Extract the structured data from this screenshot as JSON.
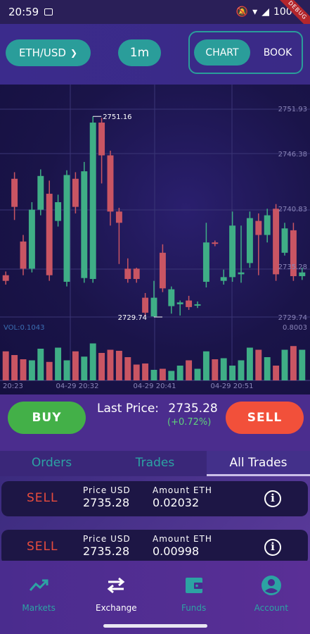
{
  "status": {
    "time": "20:59",
    "battery": "100%",
    "debug_label": "DEBUG"
  },
  "header": {
    "pair": "ETH/USD",
    "timeframe": "1m",
    "view_tabs": [
      {
        "label": "CHART",
        "active": true
      },
      {
        "label": "BOOK",
        "active": false
      }
    ]
  },
  "chart_data": {
    "type": "candlestick",
    "y_tick_labels": [
      "2751.93",
      "2746.38",
      "2740.83",
      "2735.28",
      "2729.74",
      "0.8003"
    ],
    "x_tick_labels": [
      "20:23",
      "04-29 20:32",
      "04-29 20:41",
      "04-29 20:51"
    ],
    "high_label": "2751.16",
    "low_label": "2729.74",
    "volume_label": "VOL:0.1043",
    "ylim": [
      2729.74,
      2751.93
    ],
    "candles": [
      {
        "o": 2734.2,
        "c": 2733.6,
        "h": 2734.6,
        "l": 2733.2
      },
      {
        "o": 2744.5,
        "c": 2741.5,
        "h": 2745.2,
        "l": 2740.1
      },
      {
        "o": 2737.8,
        "c": 2734.9,
        "h": 2738.5,
        "l": 2734.2
      },
      {
        "o": 2734.9,
        "c": 2741.2,
        "h": 2742.0,
        "l": 2734.5
      },
      {
        "o": 2741.2,
        "c": 2744.8,
        "h": 2745.5,
        "l": 2740.6
      },
      {
        "o": 2742.9,
        "c": 2734.2,
        "h": 2744.3,
        "l": 2733.6
      },
      {
        "o": 2740.0,
        "c": 2742.0,
        "h": 2742.8,
        "l": 2739.4
      },
      {
        "o": 2733.5,
        "c": 2744.9,
        "h": 2745.4,
        "l": 2733.0
      },
      {
        "o": 2744.5,
        "c": 2741.5,
        "h": 2745.2,
        "l": 2740.8
      },
      {
        "o": 2733.9,
        "c": 2745.3,
        "h": 2746.3,
        "l": 2733.4
      },
      {
        "o": 2733.8,
        "c": 2750.5,
        "h": 2751.16,
        "l": 2733.4
      },
      {
        "o": 2750.5,
        "c": 2747.0,
        "h": 2751.0,
        "l": 2744.0
      },
      {
        "o": 2747.0,
        "c": 2741.0,
        "h": 2747.5,
        "l": 2739.5
      },
      {
        "o": 2741.0,
        "c": 2739.8,
        "h": 2741.4,
        "l": 2735.4
      },
      {
        "o": 2734.9,
        "c": 2733.8,
        "h": 2736.0,
        "l": 2733.4
      },
      {
        "o": 2734.9,
        "c": 2733.8,
        "h": 2735.0,
        "l": 2733.4
      },
      {
        "o": 2731.8,
        "c": 2730.2,
        "h": 2732.3,
        "l": 2729.8
      },
      {
        "o": 2729.8,
        "c": 2731.8,
        "h": 2733.6,
        "l": 2729.74
      },
      {
        "o": 2736.6,
        "c": 2732.8,
        "h": 2737.5,
        "l": 2732.4
      },
      {
        "o": 2730.9,
        "c": 2732.7,
        "h": 2733.0,
        "l": 2730.1
      },
      {
        "o": 2731.1,
        "c": 2731.3,
        "h": 2731.5,
        "l": 2729.9
      },
      {
        "o": 2731.5,
        "c": 2730.8,
        "h": 2732.0,
        "l": 2730.5
      },
      {
        "o": 2731.0,
        "c": 2731.1,
        "h": 2731.4,
        "l": 2730.7
      },
      {
        "o": 2733.5,
        "c": 2737.7,
        "h": 2739.8,
        "l": 2732.9
      },
      {
        "o": 2737.7,
        "c": 2737.6,
        "h": 2737.9,
        "l": 2737.3
      },
      {
        "o": 2733.6,
        "c": 2734.0,
        "h": 2734.8,
        "l": 2733.2
      },
      {
        "o": 2734.0,
        "c": 2739.5,
        "h": 2741.0,
        "l": 2733.5
      },
      {
        "o": 2734.3,
        "c": 2734.5,
        "h": 2739.5,
        "l": 2733.4
      },
      {
        "o": 2735.5,
        "c": 2740.3,
        "h": 2741.0,
        "l": 2735.0
      },
      {
        "o": 2740.0,
        "c": 2738.5,
        "h": 2740.8,
        "l": 2734.2
      },
      {
        "o": 2738.5,
        "c": 2740.6,
        "h": 2741.3,
        "l": 2737.7
      },
      {
        "o": 2741.3,
        "c": 2734.3,
        "h": 2741.8,
        "l": 2733.6
      },
      {
        "o": 2736.6,
        "c": 2739.2,
        "h": 2739.8,
        "l": 2736.3
      },
      {
        "o": 2739.0,
        "c": 2734.1,
        "h": 2739.8,
        "l": 2733.6
      },
      {
        "o": 2734.1,
        "c": 2734.5,
        "h": 2735.0,
        "l": 2733.7
      }
    ],
    "volumes": [
      0.55,
      0.48,
      0.4,
      0.38,
      0.6,
      0.35,
      0.62,
      0.38,
      0.55,
      0.45,
      0.7,
      0.52,
      0.58,
      0.56,
      0.44,
      0.3,
      0.32,
      0.2,
      0.22,
      0.18,
      0.28,
      0.38,
      0.22,
      0.55,
      0.4,
      0.42,
      0.28,
      0.38,
      0.62,
      0.58,
      0.44,
      0.28,
      0.58,
      0.65,
      0.58
    ]
  },
  "actions": {
    "buy": "BUY",
    "sell": "SELL",
    "last_price_label": "Last Price:",
    "last_price_value": "2735.28",
    "last_price_change": "(+0.72%)"
  },
  "tabs": [
    {
      "label": "Orders"
    },
    {
      "label": "Trades"
    },
    {
      "label": "All Trades",
      "active": true
    }
  ],
  "trades": [
    {
      "side": "SELL",
      "price_label": "Price USD",
      "price": "2735.28",
      "amount_label": "Amount ETH",
      "amount": "0.02032"
    },
    {
      "side": "SELL",
      "price_label": "Price USD",
      "price": "2735.28",
      "amount_label": "Amount ETH",
      "amount": "0.00998"
    }
  ],
  "nav": [
    {
      "label": "Markets",
      "icon": "trending-up-icon"
    },
    {
      "label": "Exchange",
      "icon": "swap-icon",
      "active": true
    },
    {
      "label": "Funds",
      "icon": "wallet-icon"
    },
    {
      "label": "Account",
      "icon": "account-icon"
    }
  ],
  "colors": {
    "up": "#3fae86",
    "down": "#c95563",
    "accent": "#2a9d9a",
    "buy": "#43b048",
    "sell": "#f2503a"
  }
}
